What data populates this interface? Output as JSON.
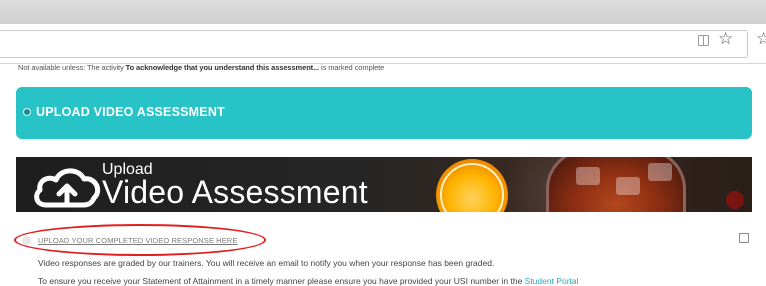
{
  "browser": {
    "toolbar_icons": [
      "reader-mode-icon",
      "bookmark-star-icon",
      "bookmark-star-icon"
    ]
  },
  "restriction": {
    "prefix": "Not available unless: The activity ",
    "activity": "To acknowledge that you understand this assessment...",
    "suffix": " is marked complete"
  },
  "section": {
    "title": "UPLOAD VIDEO ASSESSMENT",
    "accent": "#27c3c6"
  },
  "hero": {
    "line1": "Upload",
    "line2": "Video Assessment",
    "icon": "cloud-upload-icon"
  },
  "activity": {
    "link": "UPLOAD YOUR COMPLETED VIDEO RESPONSE HERE",
    "highlight": "#e02020",
    "description1": "Video responses are graded by our trainers. You will receive an email to notify you when your response has been graded.",
    "description2": "To ensure you receive your Statement of Attainment in a timely manner please ensure you have provided your USI number in the ",
    "portal_link": "Student Portal",
    "link_color": "#2aa8b8"
  }
}
